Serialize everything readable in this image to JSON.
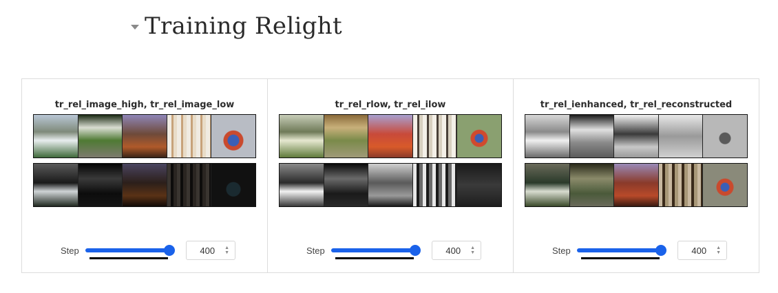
{
  "section": {
    "title": "Training Relight"
  },
  "panels": [
    {
      "title": "tr_rel_image_high, tr_rel_image_low",
      "step_label": "Step",
      "step_value": "400",
      "slider_fraction": 1.0
    },
    {
      "title": "tr_rel_rlow, tr_rel_ilow",
      "step_label": "Step",
      "step_value": "400",
      "slider_fraction": 1.0
    },
    {
      "title": "tr_rel_ienhanced, tr_rel_reconstructed",
      "step_label": "Step",
      "step_value": "400",
      "slider_fraction": 1.0
    }
  ],
  "colors": {
    "accent": "#1a62ea"
  }
}
